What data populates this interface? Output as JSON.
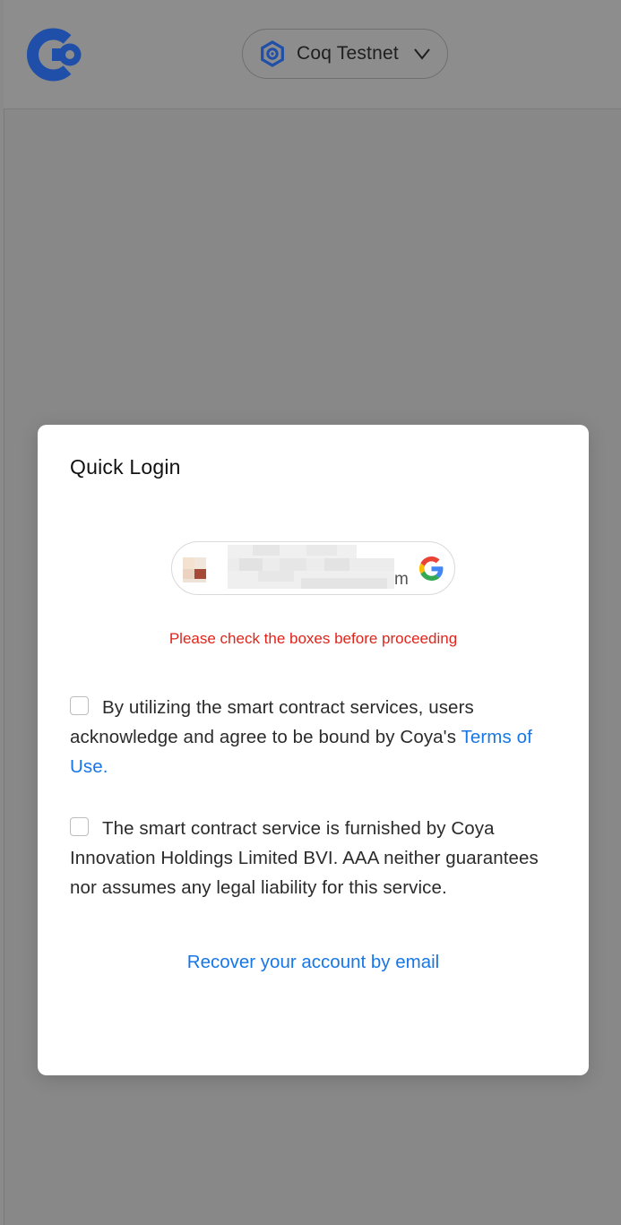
{
  "header": {
    "network_label": "Coq Testnet",
    "brand_color": "#1f4fa8"
  },
  "modal": {
    "title": "Quick Login",
    "account": {
      "suffix": "m",
      "provider_icon": "google-icon"
    },
    "error": "Please check the boxes before proceeding",
    "consent1": {
      "text": "By utilizing the smart contract services, users acknowledge and agree to be bound by Coya's ",
      "link": "Terms of Use."
    },
    "consent2": {
      "text": "The smart contract service is furnished by Coya Innovation Holdings Limited BVI. AAA neither guarantees nor assumes any legal liability for this service."
    },
    "recover_link": "Recover your account by email"
  },
  "colors": {
    "overlay": "#888888",
    "error": "#e0241b",
    "link": "#1877e6"
  }
}
